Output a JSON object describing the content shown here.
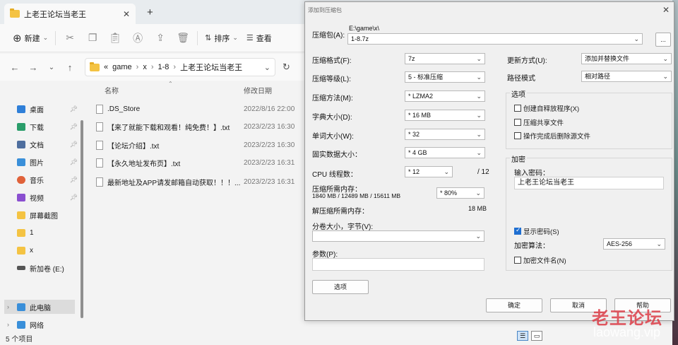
{
  "explorer": {
    "tab_title": "上老王论坛当老王",
    "toolbar": {
      "new_label": "新建",
      "sort_label": "排序",
      "view_label": "查看"
    },
    "breadcrumb": [
      "«",
      "game",
      "x",
      "1-8",
      "上老王论坛当老王"
    ],
    "columns": {
      "name": "名称",
      "date": "修改日期"
    },
    "files": [
      {
        "name": ".DS_Store",
        "date": "2022/8/16 22:00"
      },
      {
        "name": "【来了就能下载和观看！纯免费！】.txt",
        "date": "2023/2/23 16:30"
      },
      {
        "name": "【论坛介绍】.txt",
        "date": "2023/2/23 16:30"
      },
      {
        "name": "【永久地址发布页】.txt",
        "date": "2023/2/23 16:31"
      },
      {
        "name": "最新地址及APP请发邮箱自动获取！！！...",
        "date": "2023/2/23 16:31"
      }
    ],
    "nav_items": [
      {
        "label": "桌面",
        "icon": "desktop-icon",
        "color": "#2f7fd8"
      },
      {
        "label": "下载",
        "icon": "download-icon",
        "color": "#2a9d6a"
      },
      {
        "label": "文档",
        "icon": "documents-icon",
        "color": "#4e6e9e"
      },
      {
        "label": "图片",
        "icon": "pictures-icon",
        "color": "#3a8fd9"
      },
      {
        "label": "音乐",
        "icon": "music-icon",
        "color": "#e0623a"
      },
      {
        "label": "视频",
        "icon": "videos-icon",
        "color": "#8a4fd0"
      },
      {
        "label": "屏幕截图",
        "icon": "folder-icon",
        "color": "#f4c343"
      },
      {
        "label": "1",
        "icon": "folder-icon",
        "color": "#f4c343"
      },
      {
        "label": "x",
        "icon": "folder-icon",
        "color": "#f4c343"
      },
      {
        "label": "新加卷 (E:)",
        "icon": "drive-icon",
        "color": "#555555"
      },
      {
        "label": "此电脑",
        "icon": "computer-icon",
        "color": "#3a8fd9"
      },
      {
        "label": "网络",
        "icon": "network-icon",
        "color": "#3a8fd9"
      }
    ],
    "status": "5 个项目"
  },
  "dialog": {
    "title": "添加到压缩包",
    "archive_label": "压缩包(A):",
    "archive_path": "E:\\game\\x\\",
    "archive_name": "1-8.7z",
    "browse_label": "...",
    "format_label": "压缩格式(F):",
    "format_value": "7z",
    "level_label": "压缩等级(L):",
    "level_value": "5 - 标准压缩",
    "method_label": "压缩方法(M):",
    "method_value": "* LZMA2",
    "dict_label": "字典大小(D):",
    "dict_value": "* 16 MB",
    "word_label": "单词大小(W):",
    "word_value": "* 32",
    "solid_label": "固实数据大小：",
    "solid_value": "* 4 GB",
    "threads_label": "CPU 线程数：",
    "threads_value": "* 12",
    "threads_max": "/ 12",
    "mem_label": "压缩所需内存：",
    "mem_detail": "1840 MB / 12489 MB / 15611 MB",
    "mem_value": "* 80%",
    "decomp_label": "解压缩所需内存：",
    "decomp_value": "18 MB",
    "split_label": "分卷大小，字节(V):",
    "split_value": "",
    "params_label": "参数(P):",
    "params_value": "",
    "options_button": "选项",
    "update_label": "更新方式(U):",
    "update_value": "添加并替换文件",
    "path_label": "路径模式",
    "path_value": "相对路径",
    "options_group": "选项",
    "opt_sfx": "创建自释放程序(X)",
    "opt_shared": "压缩共享文件",
    "opt_delete": "操作完成后删除源文件",
    "encrypt_group": "加密",
    "password_label": "输入密码：",
    "password_value": "上老王论坛当老王",
    "show_password": "显示密码(S)",
    "enc_method_label": "加密算法：",
    "enc_method_value": "AES-256",
    "enc_names": "加密文件名(N)",
    "ok": "确定",
    "cancel": "取消",
    "help": "帮助"
  },
  "watermark": {
    "line1": "老王论坛",
    "line2": "laowang.vip"
  }
}
